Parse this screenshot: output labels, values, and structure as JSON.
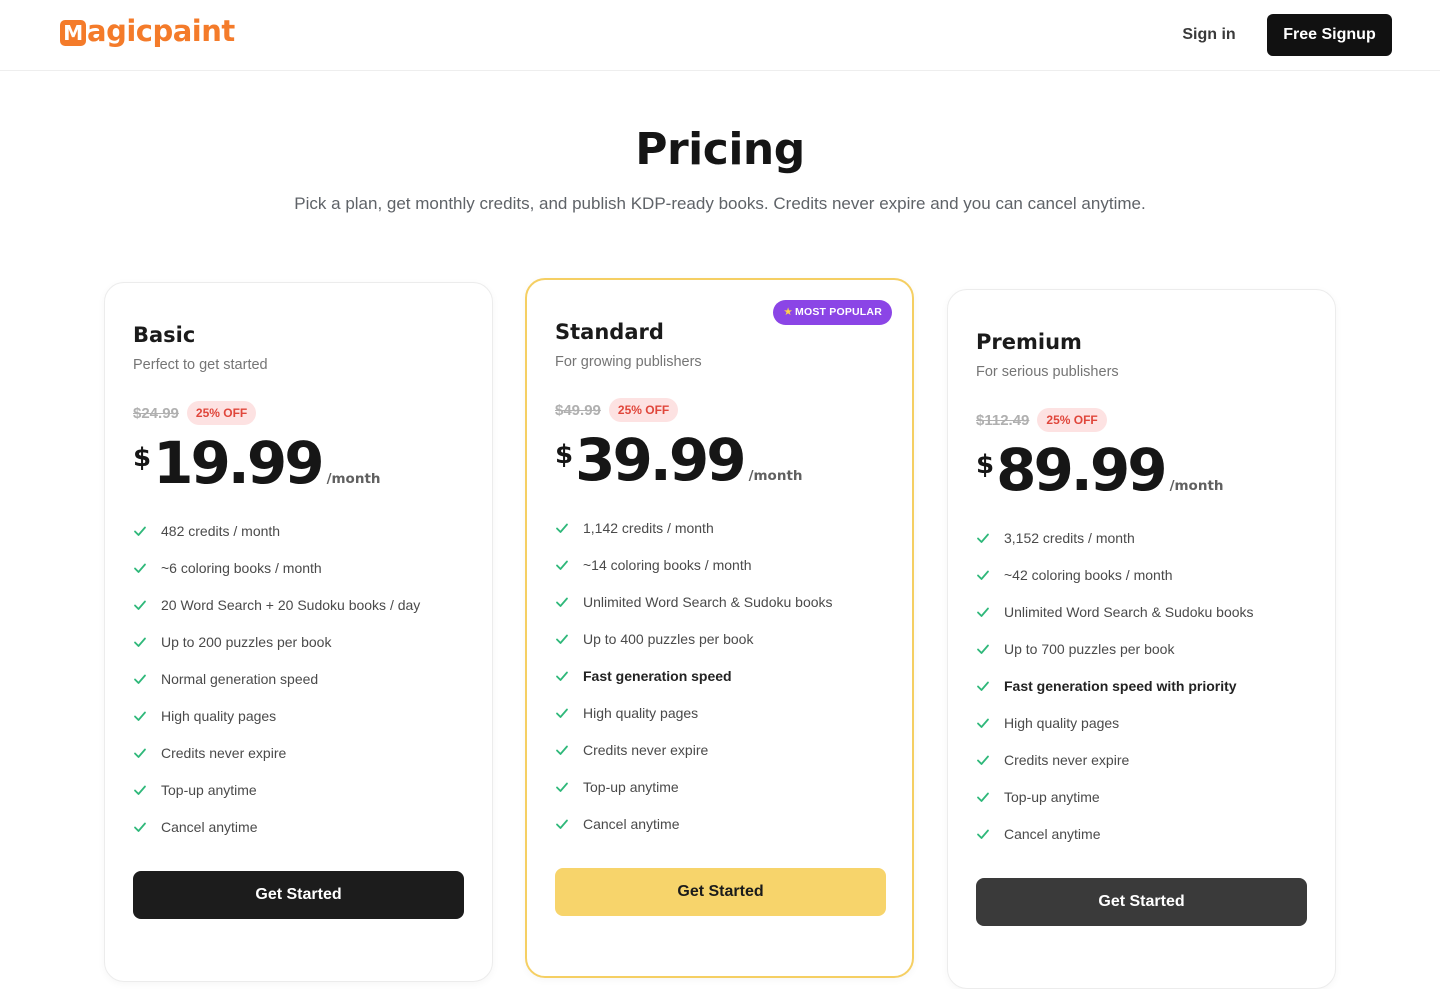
{
  "header": {
    "logo_mark": "M",
    "logo_text": "agicpaint",
    "signin_label": "Sign in",
    "signup_label": "Free Signup"
  },
  "hero": {
    "title": "Pricing",
    "subtitle": "Pick a plan, get monthly credits, and publish KDP-ready books. Credits never expire and you can cancel anytime."
  },
  "plans": [
    {
      "name": "Basic",
      "description": "Perfect to get started",
      "old_price": "$24.99",
      "discount": "25% OFF",
      "currency": "$",
      "price": "19.99",
      "period": "/month",
      "features": [
        "482 credits / month",
        "~6 coloring books / month",
        "20 Word Search + 20 Sudoku books / day",
        "Up to 200 puzzles per book",
        "Normal generation speed",
        "High quality pages",
        "Credits never expire",
        "Top-up anytime",
        "Cancel anytime"
      ],
      "cta": "Get Started"
    },
    {
      "name": "Standard",
      "badge": "MOST POPULAR",
      "description": "For growing publishers",
      "old_price": "$49.99",
      "discount": "25% OFF",
      "currency": "$",
      "price": "39.99",
      "period": "/month",
      "features": [
        "1,142 credits / month",
        "~14 coloring books / month",
        "Unlimited Word Search & Sudoku books",
        "Up to 400 puzzles per book",
        "Fast generation speed",
        "High quality pages",
        "Credits never expire",
        "Top-up anytime",
        "Cancel anytime"
      ],
      "cta": "Get Started"
    },
    {
      "name": "Premium",
      "description": "For serious publishers",
      "old_price": "$112.49",
      "discount": "25% OFF",
      "currency": "$",
      "price": "89.99",
      "period": "/month",
      "features": [
        "3,152 credits / month",
        "~42 coloring books / month",
        "Unlimited Word Search & Sudoku books",
        "Up to 700 puzzles per book",
        "Fast generation speed with priority",
        "High quality pages",
        "Credits never expire",
        "Top-up anytime",
        "Cancel anytime"
      ],
      "cta": "Get Started"
    }
  ],
  "colors": {
    "brand": "#f47b2a",
    "featured_border": "#f5cf63",
    "badge": "#8b45e6",
    "check": "#2fb87a",
    "discount_bg": "#fde2e2",
    "discount_text": "#e0463b"
  }
}
